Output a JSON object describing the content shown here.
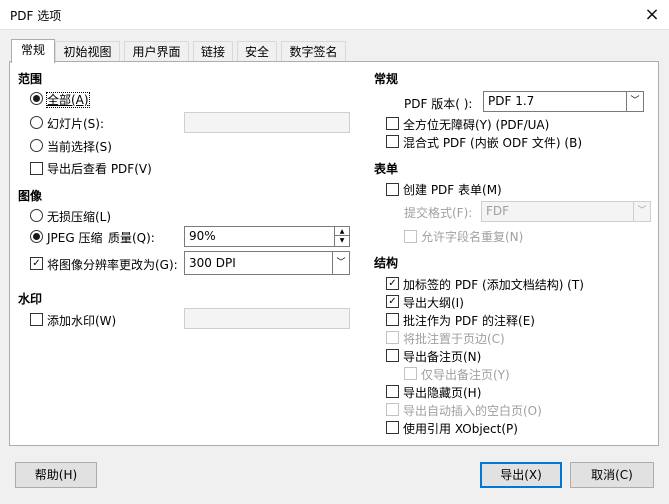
{
  "window": {
    "title": "PDF 选项",
    "close": "×"
  },
  "tabs": [
    "常规",
    "初始视图",
    "用户界面",
    "链接",
    "安全",
    "数字签名"
  ],
  "range": {
    "heading": "范围",
    "all": "全部(A)",
    "slides": "幻灯片(S):",
    "slides_value": "",
    "selection": "当前选择(S)",
    "view_after": "导出后查看 PDF(V)"
  },
  "images": {
    "heading": "图像",
    "lossless": "无损压缩(L)",
    "jpeg": "JPEG 压缩",
    "quality_label": "质量(Q):",
    "quality_value": "90%",
    "reduce": "将图像分辨率更改为(G):",
    "reduce_value": "300 DPI"
  },
  "watermark": {
    "heading": "水印",
    "add": "添加水印(W)",
    "text_value": ""
  },
  "general": {
    "heading": "常规",
    "version_label": "PDF 版本( ):",
    "version_value": "PDF 1.7",
    "ua": "全方位无障碍(Y) (PDF/UA)",
    "hybrid": "混合式 PDF (内嵌 ODF 文件) (B)"
  },
  "forms": {
    "heading": "表单",
    "create": "创建 PDF 表单(M)",
    "submit_label": "提交格式(F):",
    "submit_value": "FDF",
    "dup_names": "允许字段名重复(N)"
  },
  "structure": {
    "heading": "结构",
    "tagged": "加标签的 PDF (添加文档结构) (T)",
    "outline": "导出大纲(I)",
    "comments": "批注作为 PDF 的注释(E)",
    "comments_margin": "将批注置于页边(C)",
    "notes": "导出备注页(N)",
    "notes_only": "仅导出备注页(Y)",
    "hidden": "导出隐藏页(H)",
    "blank": "导出自动插入的空白页(O)",
    "xobject": "使用引用 XObject(P)"
  },
  "buttons": {
    "help": "帮助(H)",
    "export": "导出(X)",
    "cancel": "取消(C)"
  },
  "check_mark": "✓"
}
